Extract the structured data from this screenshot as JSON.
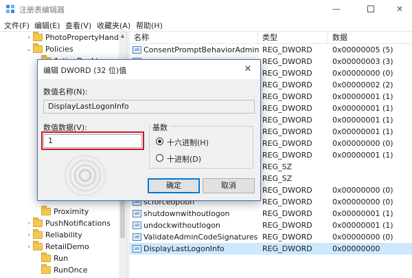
{
  "window": {
    "title": "注册表编辑器"
  },
  "menu": [
    {
      "label": "文件(F)"
    },
    {
      "label": "编辑(E)"
    },
    {
      "label": "查看(V)"
    },
    {
      "label": "收藏夹(A)"
    },
    {
      "label": "帮助(H)"
    }
  ],
  "tree": [
    {
      "label": "PhotoPropertyHand",
      "chevron": "›"
    },
    {
      "label": "Policies",
      "chevron": "⌄"
    },
    {
      "label": "ActiveDesktop",
      "chevron": ""
    },
    {
      "label": "Proximity",
      "chevron": ""
    },
    {
      "label": "PushNotifications",
      "chevron": "›"
    },
    {
      "label": "Reliability",
      "chevron": "›"
    },
    {
      "label": "RetailDemo",
      "chevron": "›"
    },
    {
      "label": "Run",
      "chevron": ""
    },
    {
      "label": "RunOnce",
      "chevron": ""
    }
  ],
  "list": {
    "columns": {
      "name": "名称",
      "type": "类型",
      "data": "数据"
    },
    "rows": [
      {
        "name": "ConsentPromptBehaviorAdmin",
        "type": "REG_DWORD",
        "data": "0x00000005 (5)",
        "icon": "ab"
      },
      {
        "name": "",
        "type": "REG_DWORD",
        "data": "0x00000003 (3)",
        "icon": "ab"
      },
      {
        "name": "",
        "type": "REG_DWORD",
        "data": "0x00000000 (0)",
        "icon": "ab"
      },
      {
        "name": "",
        "type": "REG_DWORD",
        "data": "0x00000002 (2)",
        "icon": "ab"
      },
      {
        "name": "",
        "type": "REG_DWORD",
        "data": "0x00000001 (1)",
        "icon": "ab"
      },
      {
        "name": "",
        "type": "REG_DWORD",
        "data": "0x00000001 (1)",
        "icon": "ab"
      },
      {
        "name": "",
        "type": "REG_DWORD",
        "data": "0x00000001 (1)",
        "icon": "ab"
      },
      {
        "name": "",
        "type": "REG_DWORD",
        "data": "0x00000001 (1)",
        "icon": "ab"
      },
      {
        "name": "",
        "type": "REG_DWORD",
        "data": "0x00000000 (0)",
        "icon": "ab"
      },
      {
        "name": "",
        "type": "REG_DWORD",
        "data": "0x00000001 (1)",
        "icon": "ab"
      },
      {
        "name": "",
        "type": "REG_SZ",
        "data": "",
        "icon": "ab"
      },
      {
        "name": "",
        "type": "REG_SZ",
        "data": "",
        "icon": "ab"
      },
      {
        "name": "",
        "type": "REG_DWORD",
        "data": "0x00000000 (0)",
        "icon": "ab"
      },
      {
        "name": "scforceoption",
        "type": "REG_DWORD",
        "data": "0x00000000 (0)",
        "icon": "ab"
      },
      {
        "name": "shutdownwithoutlogon",
        "type": "REG_DWORD",
        "data": "0x00000001 (1)",
        "icon": "ab"
      },
      {
        "name": "undockwithoutlogon",
        "type": "REG_DWORD",
        "data": "0x00000001 (1)",
        "icon": "ab"
      },
      {
        "name": "ValidateAdminCodeSignatures",
        "type": "REG_DWORD",
        "data": "0x00000000 (0)",
        "icon": "ab"
      },
      {
        "name": "DisplayLastLogonInfo",
        "type": "REG_DWORD",
        "data": "0x00000000",
        "icon": "ab",
        "selected": true
      }
    ]
  },
  "dialog": {
    "title": "编辑 DWORD (32 位)值",
    "value_name_label": "数值名称(N):",
    "value_name": "DisplayLastLogonInfo",
    "value_data_label": "数值数据(V):",
    "value_data": "1",
    "base_label": "基数",
    "base_options": [
      {
        "label": "十六进制(H)",
        "checked": true
      },
      {
        "label": "十进制(D)",
        "checked": false
      }
    ],
    "ok_label": "确定",
    "cancel_label": "取消"
  },
  "colors": {
    "highlight_border": "#d0152b",
    "selected_row": "#cce8ff",
    "folder": "#f3c94f"
  }
}
